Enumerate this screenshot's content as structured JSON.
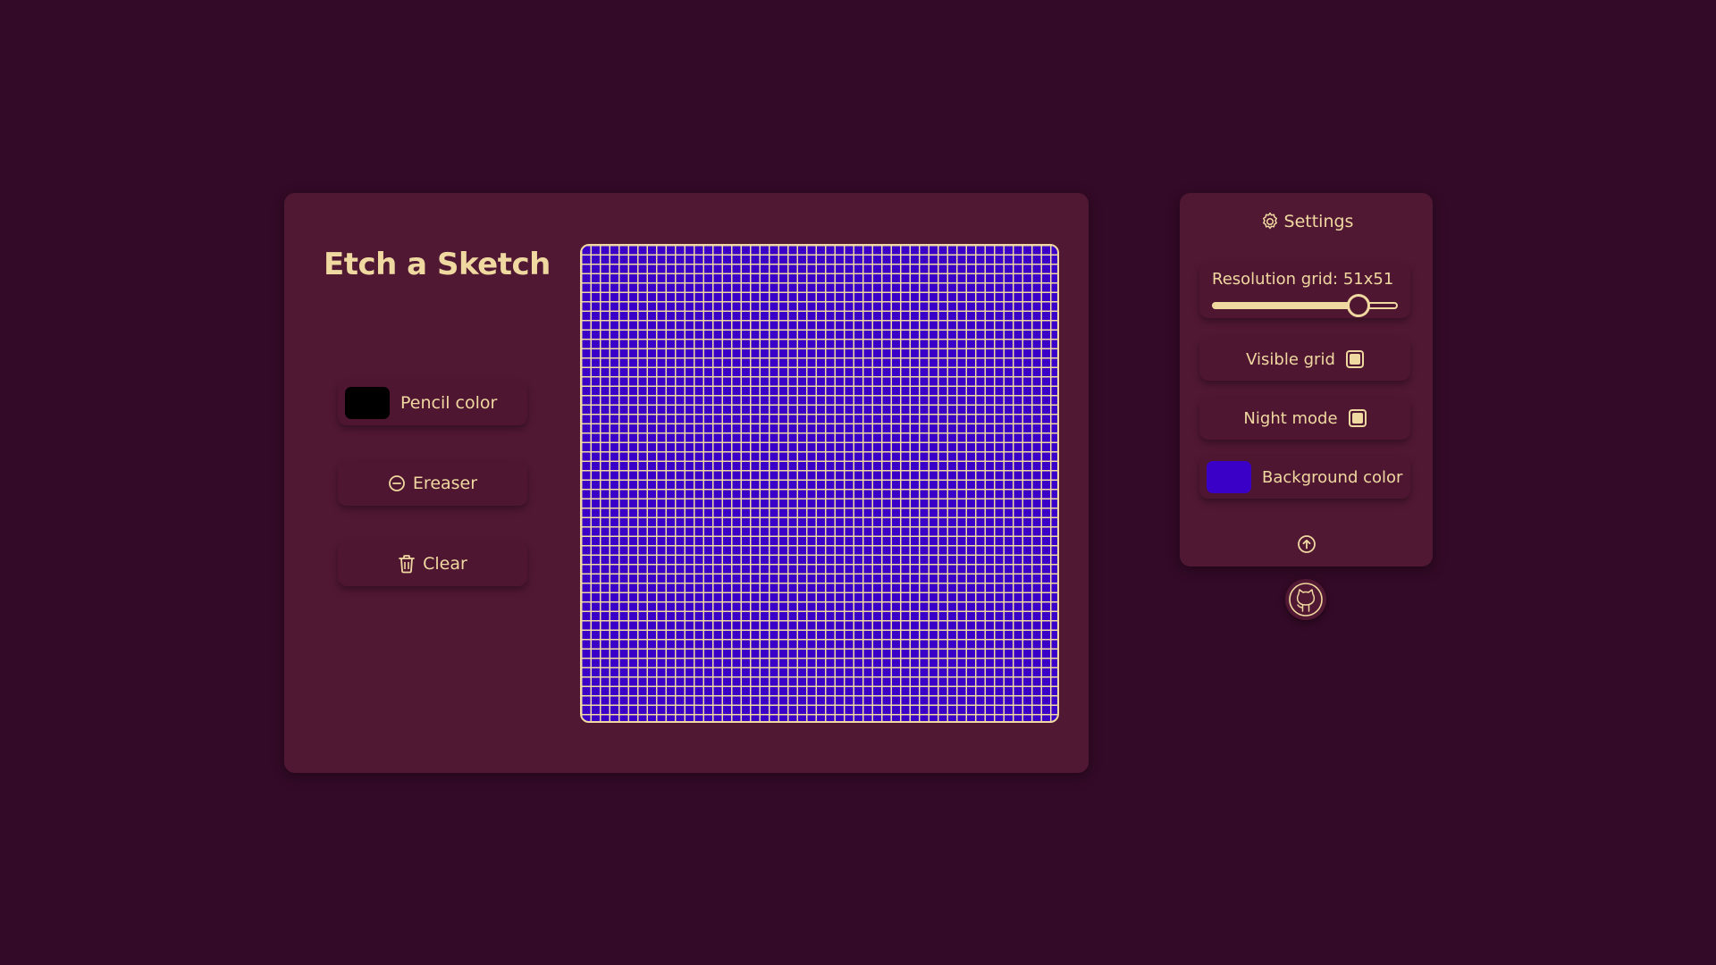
{
  "app": {
    "title": "Etch a Sketch"
  },
  "colors": {
    "page_background": "#330a27",
    "panel_background": "#511833",
    "accent": "#f0d9a0",
    "pencil_color": "#000000",
    "board_background": "#3a00c8"
  },
  "tools": {
    "pencil_label": "Pencil color",
    "eraser_label": "Ereaser",
    "eraser_icon": "minus-circle-icon",
    "clear_label": "Clear",
    "clear_icon": "trash-icon"
  },
  "board": {
    "grid_size": 51,
    "grid_visible": true
  },
  "settings": {
    "header_label": "Settings",
    "header_icon": "gear-icon",
    "resolution_label": "Resolution grid: 51x51",
    "resolution_min": 1,
    "resolution_max": 64,
    "resolution_value": 51,
    "visible_grid_label": "Visible grid",
    "visible_grid_checked": true,
    "night_mode_label": "Night mode",
    "night_mode_checked": true,
    "background_color_label": "Background color",
    "scroll_top_icon": "arrow-up-circle-icon"
  },
  "footer": {
    "github_icon": "github-icon"
  }
}
